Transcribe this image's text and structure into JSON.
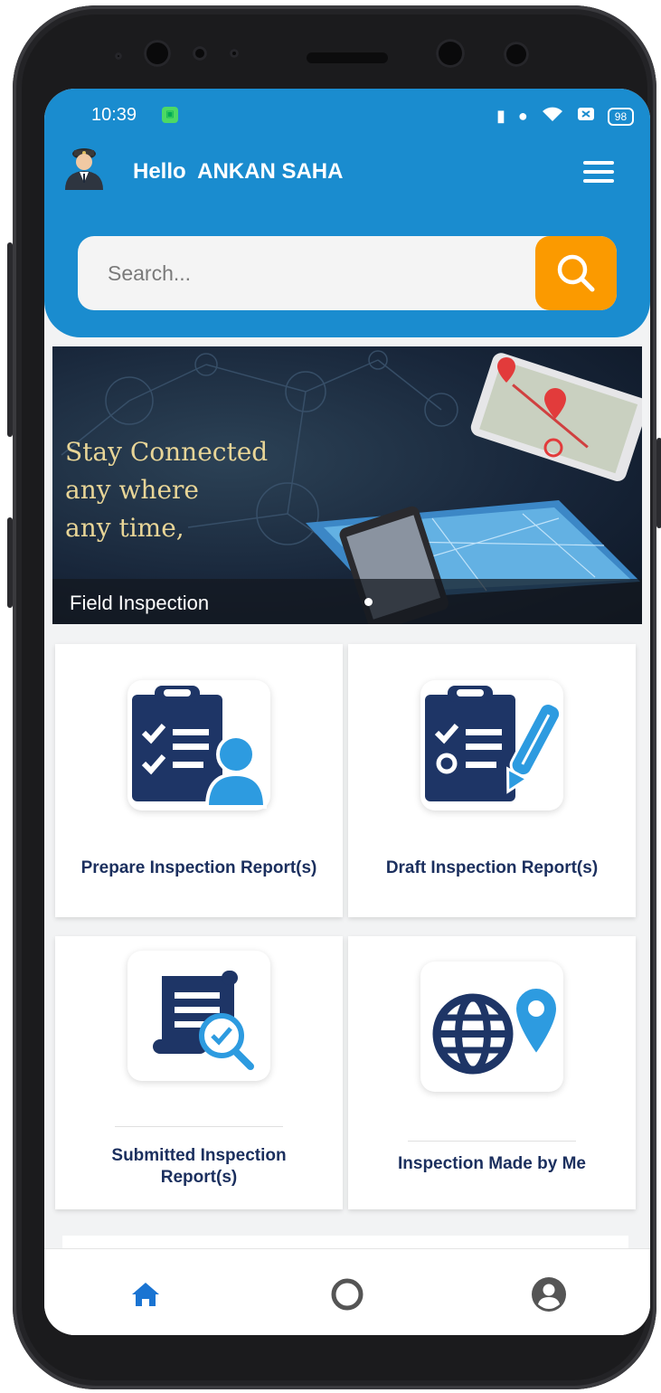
{
  "status_bar": {
    "time": "10:39",
    "battery": "98"
  },
  "header": {
    "greeting": "Hello  ANKAN SAHA"
  },
  "search": {
    "placeholder": "Search..."
  },
  "banner": {
    "headline_lines": [
      "Stay Connected",
      "any where",
      "any time,"
    ],
    "caption": "Field Inspection"
  },
  "tiles": [
    {
      "label": "Prepare Inspection Report(s)",
      "icon": "clipboard-user-icon"
    },
    {
      "label": "Draft Inspection Report(s)",
      "icon": "clipboard-pen-icon"
    },
    {
      "label_lines": [
        "Submitted Inspection",
        "Report(s)"
      ],
      "icon": "document-search-icon"
    },
    {
      "label": "Inspection Made by Me",
      "icon": "globe-pin-icon"
    }
  ],
  "bottom_nav": [
    {
      "icon": "home-icon",
      "active": true
    },
    {
      "icon": "circle-icon",
      "active": false
    },
    {
      "icon": "account-icon",
      "active": false
    }
  ],
  "colors": {
    "header": "#1a8ccf",
    "search_button": "#fb9a00",
    "tile_text": "#1b2f5e",
    "icon_navy": "#1e3566",
    "icon_blue": "#2d9be0",
    "active_nav": "#1a74d2"
  }
}
